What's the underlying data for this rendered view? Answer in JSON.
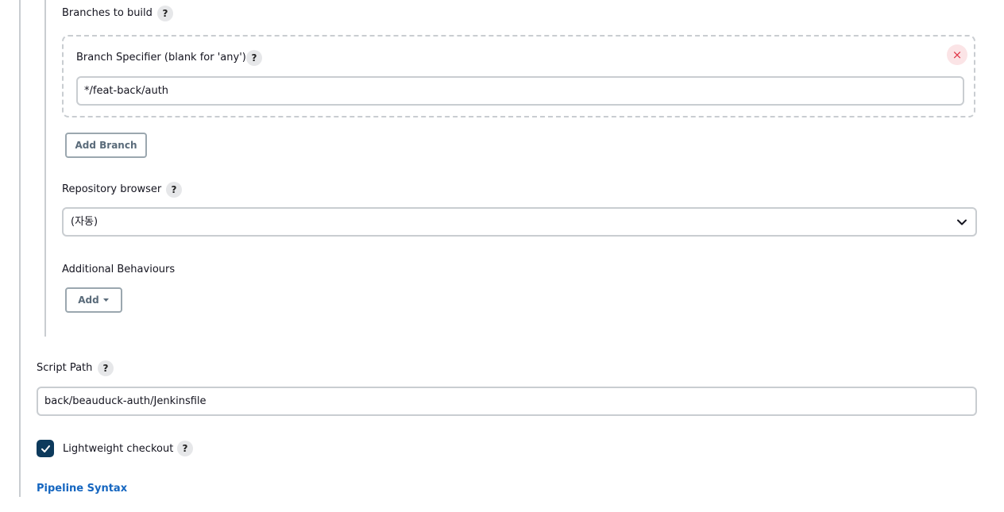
{
  "branches": {
    "section_label": "Branches to build",
    "specifier_label": "Branch Specifier (blank for 'any')",
    "specifier_value": "*/feat-back/auth",
    "remove_glyph": "×",
    "add_button": "Add Branch"
  },
  "repository_browser": {
    "label": "Repository browser",
    "selected": "(자동)"
  },
  "additional_behaviours": {
    "label": "Additional Behaviours",
    "add_button": "Add"
  },
  "script_path": {
    "label": "Script Path",
    "value": "back/beauduck-auth/Jenkinsfile"
  },
  "lightweight_checkout": {
    "label": "Lightweight checkout",
    "checked": true
  },
  "pipeline_syntax_link": "Pipeline Syntax",
  "help_glyph": "?",
  "colors": {
    "accent": "#0d3a5c",
    "link": "#1566c0",
    "danger": "#e03748",
    "border": "#c9cdd1"
  }
}
